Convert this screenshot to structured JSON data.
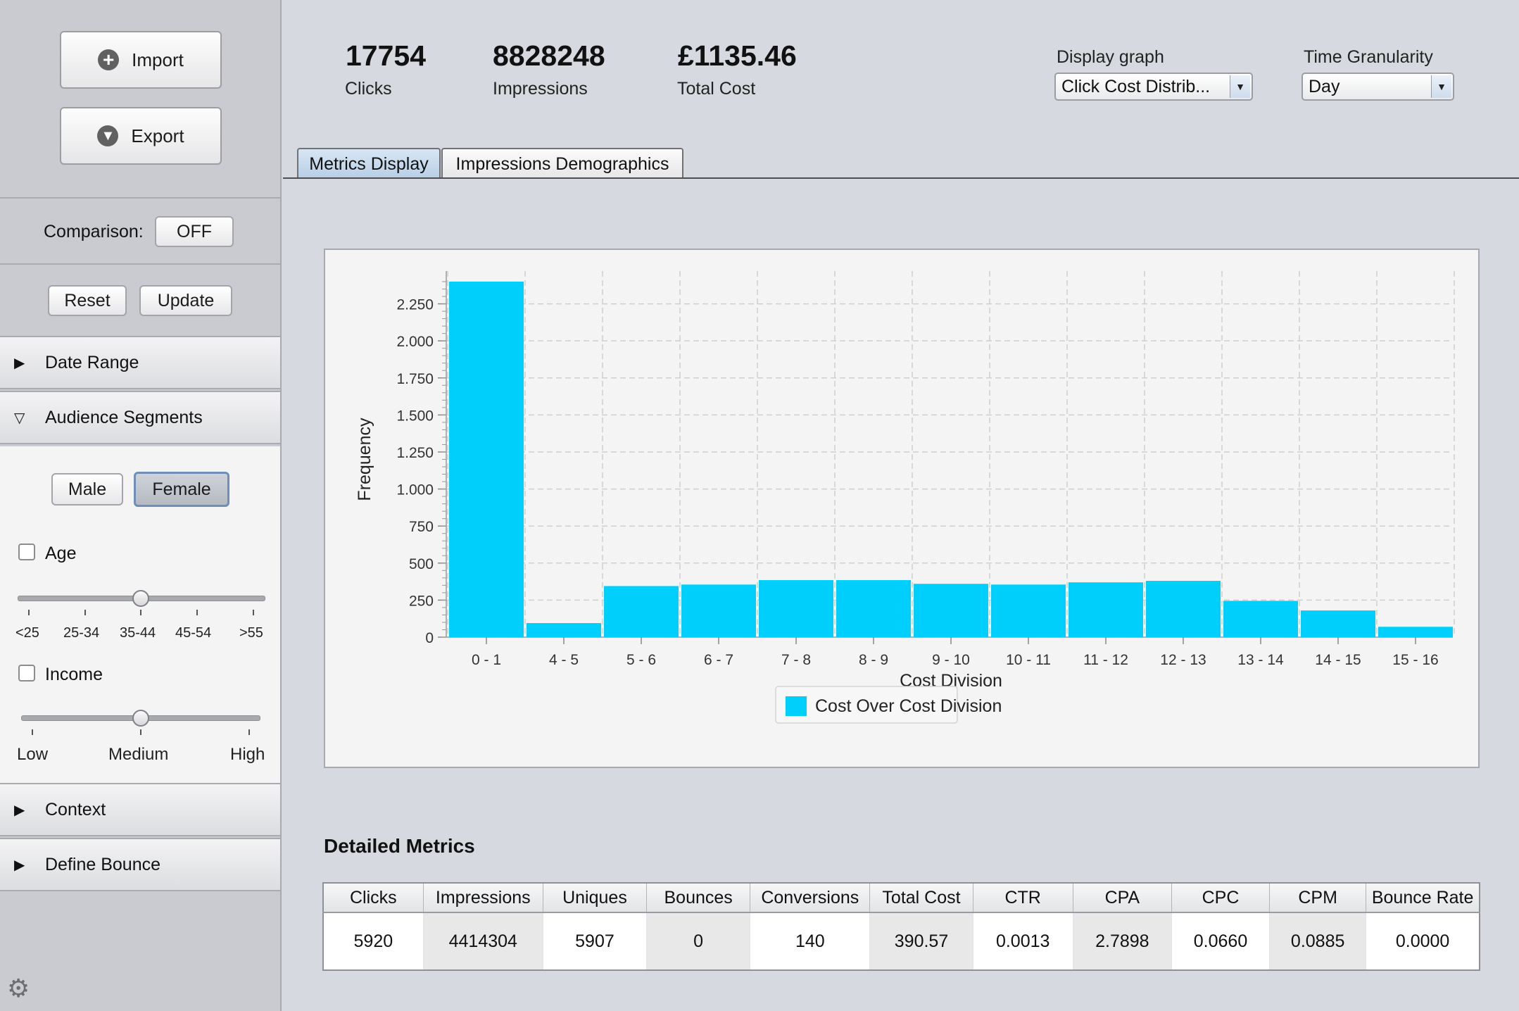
{
  "sidebar": {
    "import_label": "Import",
    "export_label": "Export",
    "comparison_label": "Comparison:",
    "comparison_value": "OFF",
    "reset_label": "Reset",
    "update_label": "Update",
    "sections": {
      "date_range": "Date Range",
      "audience_segments": "Audience Segments",
      "context": "Context",
      "define_bounce": "Define Bounce"
    },
    "gender": {
      "male": "Male",
      "female": "Female",
      "selected": "Female"
    },
    "age": {
      "label": "Age",
      "checked": false,
      "ticks": [
        "<25",
        "25-34",
        "35-44",
        "45-54",
        ">55"
      ],
      "value": "35-44"
    },
    "income": {
      "label": "Income",
      "checked": false,
      "ticks": [
        "Low",
        "Medium",
        "High"
      ],
      "value": "Medium"
    }
  },
  "summary": {
    "clicks_value": "17754",
    "clicks_label": "Clicks",
    "impressions_value": "8828248",
    "impressions_label": "Impressions",
    "cost_value": "£1135.46",
    "cost_label": "Total Cost"
  },
  "controls": {
    "display_graph_label": "Display graph",
    "display_graph_value": "Click Cost Distrib...",
    "time_granularity_label": "Time Granularity",
    "time_granularity_value": "Day"
  },
  "tabs": [
    {
      "label": "Metrics Display",
      "active": true
    },
    {
      "label": "Impressions Demographics",
      "active": false
    }
  ],
  "chart_data": {
    "type": "bar",
    "categories": [
      "0 - 1",
      "4 - 5",
      "5 - 6",
      "6 - 7",
      "7 - 8",
      "8 - 9",
      "9 - 10",
      "10 - 11",
      "11 - 12",
      "12 - 13",
      "13 - 14",
      "14 - 15",
      "15 - 16"
    ],
    "series": [
      {
        "name": "Cost Over Cost Division",
        "values": [
          2400,
          95,
          345,
          355,
          385,
          385,
          360,
          355,
          370,
          380,
          245,
          180,
          70
        ]
      }
    ],
    "xlabel": "Cost Division",
    "ylabel": "Frequency",
    "ylim": [
      0,
      2400
    ],
    "yticks": [
      "0",
      "250",
      "500",
      "750",
      "1.000",
      "1.250",
      "1.500",
      "1.750",
      "2.000",
      "2.250"
    ],
    "ytick_values": [
      0,
      250,
      500,
      750,
      1000,
      1250,
      1500,
      1750,
      2000,
      2250
    ],
    "grid": true,
    "legend": "bottom-center",
    "color": "#00cffc"
  },
  "metrics": {
    "title": "Detailed Metrics",
    "headers": [
      "Clicks",
      "Impressions",
      "Uniques",
      "Bounces",
      "Conversions",
      "Total Cost",
      "CTR",
      "CPA",
      "CPC",
      "CPM",
      "Bounce Rate"
    ],
    "values": [
      "5920",
      "4414304",
      "5907",
      "0",
      "140",
      "390.57",
      "0.0013",
      "2.7898",
      "0.0660",
      "0.0885",
      "0.0000"
    ]
  }
}
